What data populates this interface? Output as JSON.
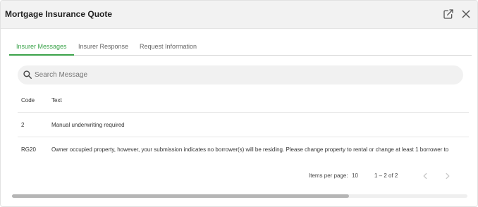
{
  "dialog": {
    "title": "Mortgage Insurance Quote",
    "open_external_icon": "open-in-new-icon",
    "close_icon": "close-icon"
  },
  "tabs": [
    {
      "label": "Insurer Messages",
      "active": true
    },
    {
      "label": "Insurer Response",
      "active": false
    },
    {
      "label": "Request Information",
      "active": false
    }
  ],
  "search": {
    "placeholder": "Search Message",
    "value": "",
    "icon": "search-icon"
  },
  "table": {
    "columns": [
      "Code",
      "Text"
    ],
    "rows": [
      {
        "code": "2",
        "text": "Manual underwriting required"
      },
      {
        "code": "RG20",
        "text": "Owner occupied property, however, your submission indicates no borrower(s) will be residing. Please change property to rental or change at least 1 borrower to"
      }
    ]
  },
  "pagination": {
    "items_per_page_label": "Items per page:",
    "items_per_page_value": "10",
    "range_label": "1 – 2 of 2",
    "prev_icon": "chevron-left-icon",
    "next_icon": "chevron-right-icon"
  },
  "scrollbar": {
    "thumb_fraction": 0.74
  },
  "colors": {
    "accent": "#3ba34a",
    "header_bg": "#f2f2f2",
    "search_bg": "#f1f1f1"
  }
}
